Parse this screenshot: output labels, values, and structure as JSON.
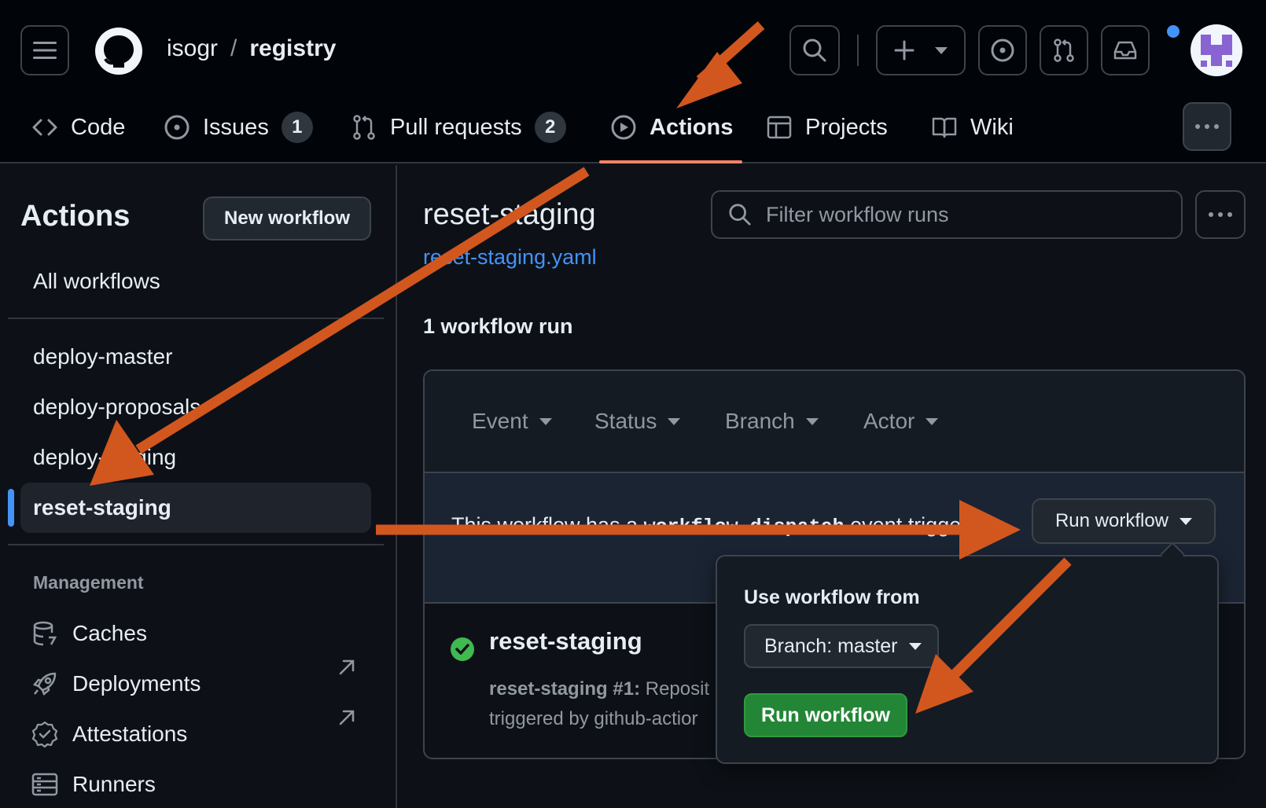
{
  "header": {
    "owner": "isogr",
    "separator": "/",
    "repo": "registry"
  },
  "tabs": [
    {
      "label": "Code",
      "icon": "code-icon"
    },
    {
      "label": "Issues",
      "count": "1",
      "icon": "issue-icon"
    },
    {
      "label": "Pull requests",
      "count": "2",
      "icon": "pull-request-icon"
    },
    {
      "label": "Actions",
      "icon": "play-icon",
      "selected": true
    },
    {
      "label": "Projects",
      "icon": "table-icon"
    },
    {
      "label": "Wiki",
      "icon": "book-icon"
    }
  ],
  "sidebar": {
    "title": "Actions",
    "new_workflow": "New workflow",
    "all_workflows": "All workflows",
    "workflows": [
      "deploy-master",
      "deploy-proposals",
      "deploy-staging",
      "reset-staging"
    ],
    "management_heading": "Management",
    "management": [
      {
        "label": "Caches",
        "icon": "database-icon"
      },
      {
        "label": "Deployments",
        "icon": "rocket-icon"
      },
      {
        "label": "Attestations",
        "icon": "verified-icon"
      },
      {
        "label": "Runners",
        "icon": "server-icon"
      }
    ]
  },
  "main": {
    "title": "reset-staging",
    "file": "reset-staging.yaml",
    "filter_placeholder": "Filter workflow runs",
    "run_count": "1 workflow run",
    "filters": [
      "Event",
      "Status",
      "Branch",
      "Actor"
    ],
    "dispatch_before": "This workflow has a ",
    "dispatch_code": "workflow_dispatch",
    "dispatch_after": " event trigger.",
    "run_workflow_button": "Run workflow",
    "run": {
      "name": "reset-staging",
      "meta_bold": "reset-staging #1:",
      "meta_rest": " Reposit",
      "meta_line2": "triggered by github-actior"
    }
  },
  "popover": {
    "label": "Use workflow from",
    "branch": "Branch: master",
    "submit": "Run workflow"
  },
  "colors": {
    "annotation_arrow": "#d2571e",
    "accent": "#4493f8",
    "success": "#238636",
    "tab_underline": "#f78166"
  }
}
